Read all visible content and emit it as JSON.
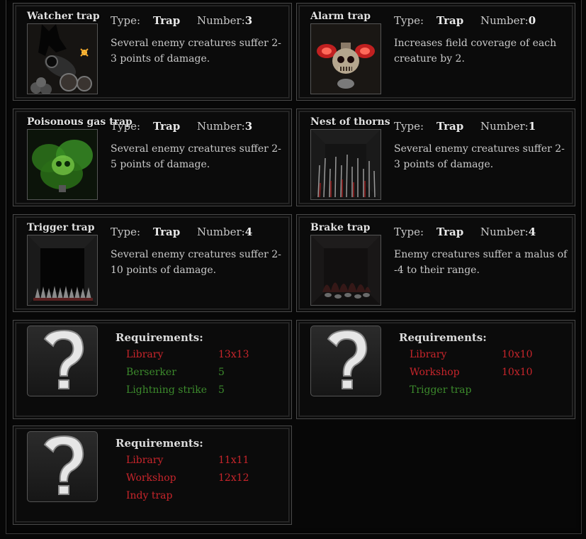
{
  "traps": [
    {
      "name": "Watcher trap",
      "type_label": "Type:",
      "type": "Trap",
      "number_label": "Number:",
      "number": "3",
      "description": "Several enemy creatures suffer 2-3 points of damage.",
      "icon": "cannon-icon"
    },
    {
      "name": "Alarm trap",
      "type_label": "Type:",
      "type": "Trap",
      "number_label": "Number:",
      "number": "0",
      "description": "Increases field coverage of each creature by 2.",
      "icon": "alarm-skull-icon"
    },
    {
      "name": "Poisonous gas trap",
      "type_label": "Type:",
      "type": "Trap",
      "number_label": "Number:",
      "number": "3",
      "description": "Several enemy creatures suffer 2-5 points of damage.",
      "icon": "poison-gas-icon"
    },
    {
      "name": "Nest of thorns",
      "type_label": "Type:",
      "type": "Trap",
      "number_label": "Number:",
      "number": "1",
      "description": "Several enemy creatures suffer 2-3 points of damage.",
      "icon": "thorns-icon"
    },
    {
      "name": "Trigger trap",
      "type_label": "Type:",
      "type": "Trap",
      "number_label": "Number:",
      "number": "4",
      "description": "Several enemy creatures suffer 2-10 points of damage.",
      "icon": "spike-trigger-icon"
    },
    {
      "name": "Brake trap",
      "type_label": "Type:",
      "type": "Trap",
      "number_label": "Number:",
      "number": "4",
      "description": "Enemy creatures suffer a malus of -4 to their range.",
      "icon": "brake-fire-icon"
    }
  ],
  "locked": [
    {
      "title": "Requirements:",
      "icon": "question-mark-icon",
      "items": [
        {
          "name": "Library",
          "value": "13x13",
          "status": "unmet"
        },
        {
          "name": "Berserker",
          "value": "5",
          "status": "met"
        },
        {
          "name": "Lightning strike",
          "value": "5",
          "status": "met"
        }
      ]
    },
    {
      "title": "Requirements:",
      "icon": "question-mark-icon",
      "items": [
        {
          "name": "Library",
          "value": "10x10",
          "status": "unmet"
        },
        {
          "name": "Workshop",
          "value": "10x10",
          "status": "unmet"
        },
        {
          "name": "Trigger trap",
          "value": "",
          "status": "met"
        }
      ]
    },
    {
      "title": "Requirements:",
      "icon": "question-mark-icon",
      "items": [
        {
          "name": "Library",
          "value": "11x11",
          "status": "unmet"
        },
        {
          "name": "Workshop",
          "value": "12x12",
          "status": "unmet"
        },
        {
          "name": "Indy trap",
          "value": "",
          "status": "unmet"
        }
      ]
    }
  ],
  "colors": {
    "unmet": "#c8252b",
    "met": "#3c8a2c",
    "background": "#070707"
  }
}
